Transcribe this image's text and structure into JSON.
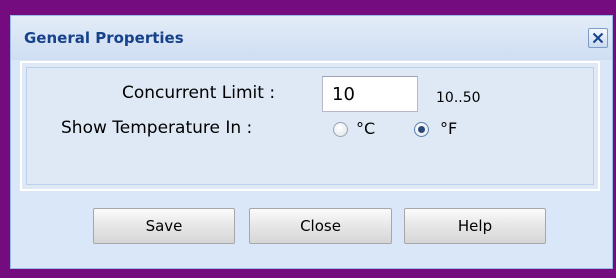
{
  "dialog": {
    "title": "General Properties"
  },
  "form": {
    "concurrent_limit_label": "Concurrent Limit :",
    "concurrent_limit_value": "10",
    "concurrent_limit_range": "10..50",
    "temperature_label": "Show Temperature In :",
    "temperature_options": [
      {
        "label": "°C",
        "checked": false
      },
      {
        "label": "°F",
        "checked": true
      }
    ]
  },
  "buttons": {
    "save": "Save",
    "close": "Close",
    "help": "Help"
  },
  "colors": {
    "frame": "#740b7e",
    "title_text": "#15428b",
    "dialog_bg": "#d9e7f8"
  }
}
